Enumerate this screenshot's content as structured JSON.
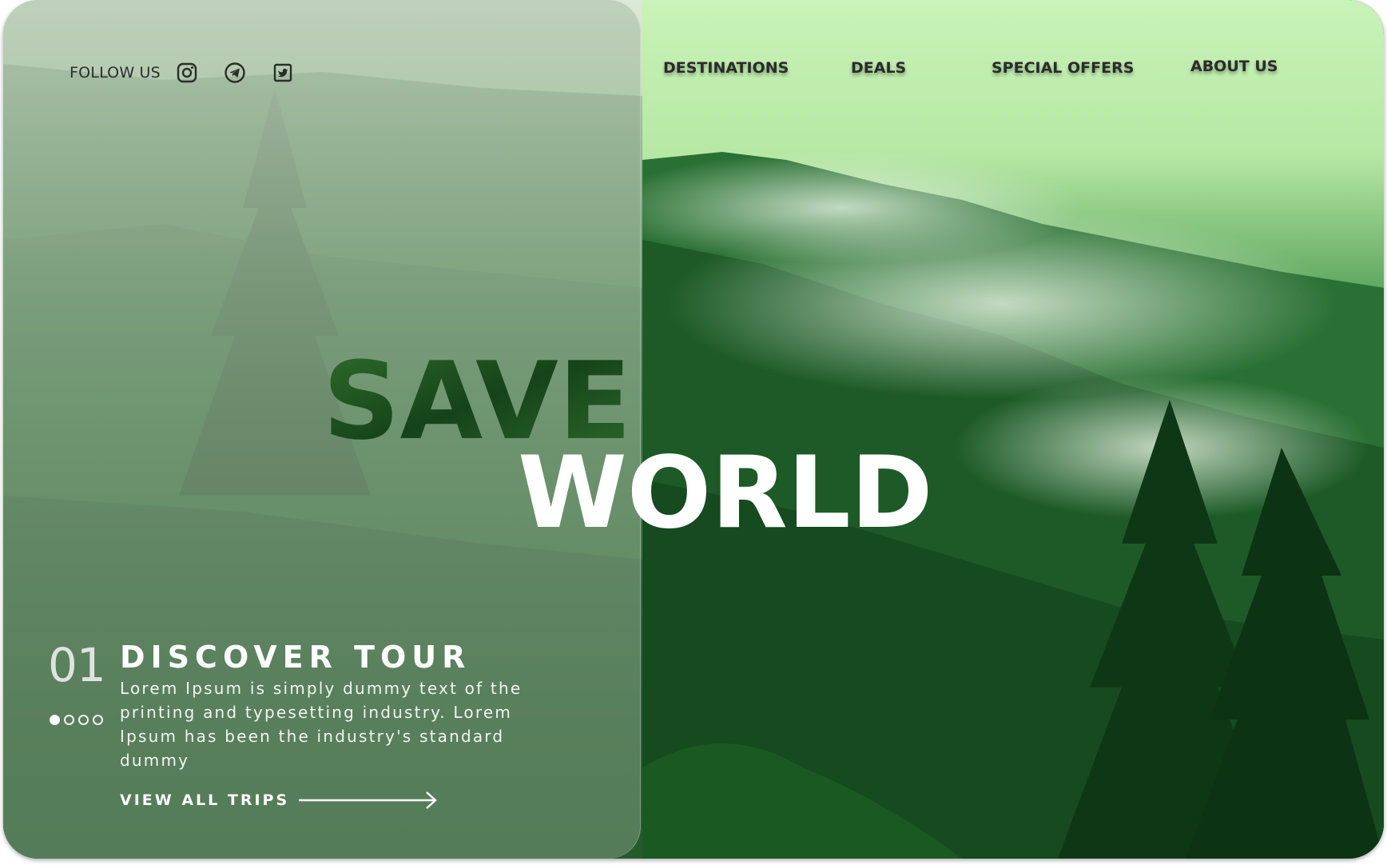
{
  "follow": {
    "label": "FOLLOW US",
    "icons": [
      "instagram-icon",
      "telegram-icon",
      "twitter-icon"
    ]
  },
  "nav": {
    "items": [
      "DESTINATIONS",
      "DEALS",
      "SPECIAL OFFERS",
      "ABOUT US"
    ]
  },
  "hero": {
    "line1": "SAVE",
    "line2": "WORLD"
  },
  "slide": {
    "number": "01",
    "title": "DISCOVER TOUR",
    "description": "Lorem Ipsum is simply dummy text of the printing and typesetting industry. Lorem Ipsum has been the industry's standard dummy",
    "cta": "VIEW ALL TRIPS",
    "dots_total": 4,
    "dots_active": 1
  },
  "colors": {
    "forest_dark": "#0f3d1a",
    "forest_mid": "#2f7a3a",
    "mist_light": "#d6f7c8",
    "panel_glass": "#96af96",
    "nav_text": "#2b2b2b",
    "white": "#ffffff"
  }
}
